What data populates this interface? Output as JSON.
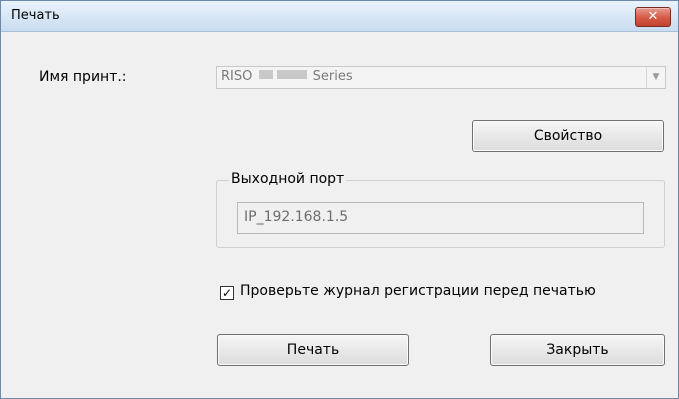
{
  "window": {
    "title": "Печать",
    "close_glyph": "✕"
  },
  "printer": {
    "label": "Имя принт.:",
    "value_prefix": "RISO",
    "value_suffix": "Series",
    "dropdown_icon": "chevron-down-icon"
  },
  "buttons": {
    "properties": "Свойство",
    "print": "Печать",
    "close": "Закрыть"
  },
  "output_port": {
    "group_title": "Выходной порт",
    "value": "IP_192.168.1.5"
  },
  "log_check": {
    "checked": true,
    "label": "Проверьте журнал регистрации перед печатью"
  }
}
